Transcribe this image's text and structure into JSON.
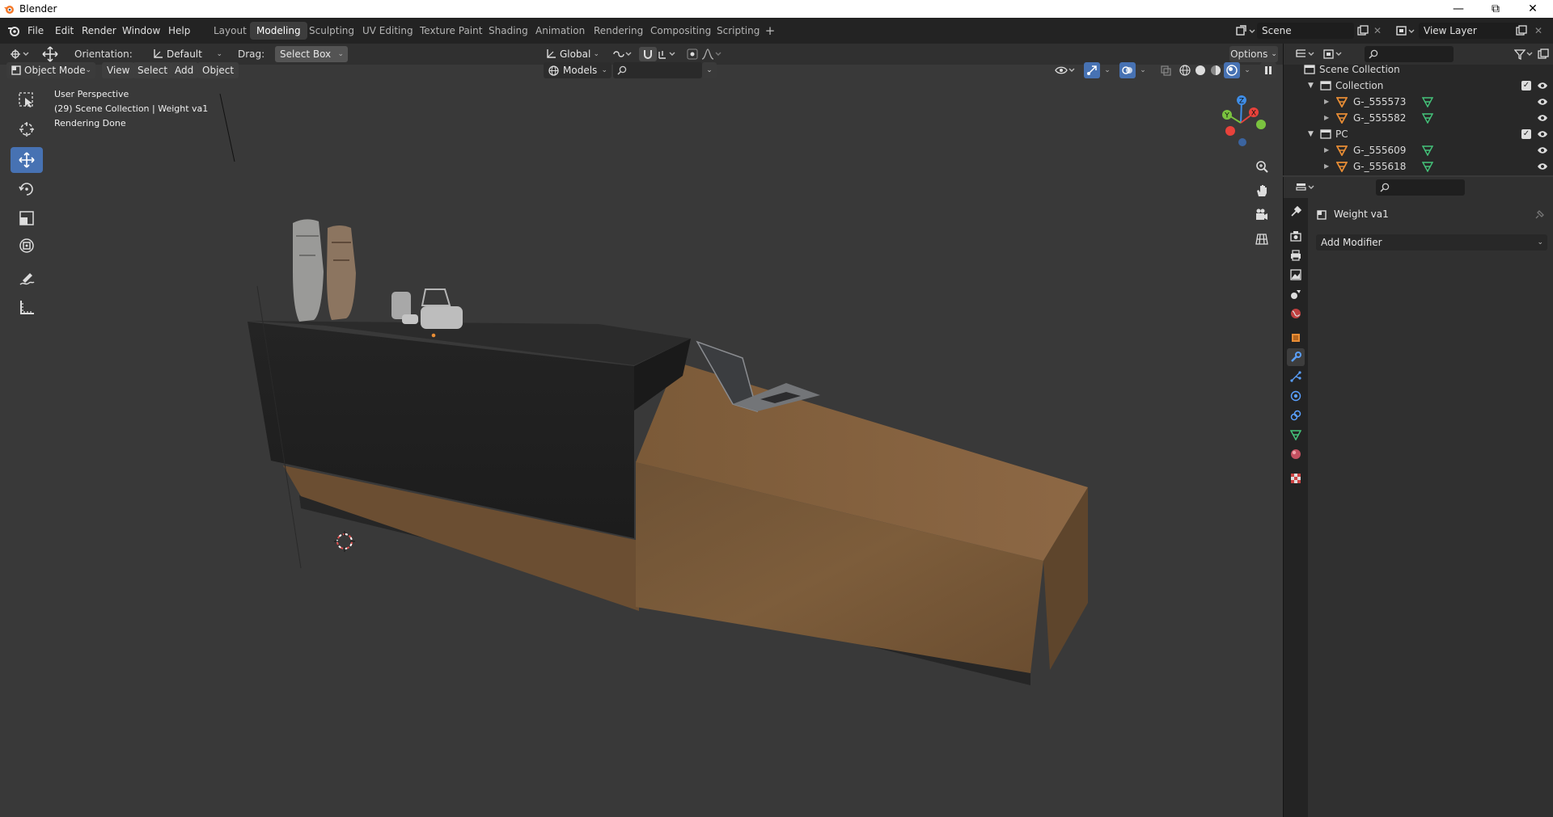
{
  "window": {
    "title": "Blender"
  },
  "menus": [
    "File",
    "Edit",
    "Render",
    "Window",
    "Help"
  ],
  "workspaces": [
    "Layout",
    "Modeling",
    "Sculpting",
    "UV Editing",
    "Texture Paint",
    "Shading",
    "Animation",
    "Rendering",
    "Compositing",
    "Scripting"
  ],
  "scene": {
    "name": "Scene",
    "view_layer": "View Layer"
  },
  "header": {
    "orientation_label": "Orientation:",
    "orientation_value": "Default",
    "drag_label": "Drag:",
    "drag_value": "Select Box",
    "transform_orientation": "Global",
    "options": "Options"
  },
  "viewport_header": {
    "mode": "Object Mode",
    "menus": [
      "View",
      "Select",
      "Add",
      "Object"
    ],
    "collection_filter": "Models"
  },
  "viewport": {
    "overlay_lines": [
      "User Perspective",
      "(29) Scene Collection | Weight va1",
      "Rendering Done"
    ],
    "gizmo_axes": [
      "Z",
      "X",
      "Y"
    ]
  },
  "outliner": {
    "root": "Scene Collection",
    "items": [
      {
        "name": "Collection",
        "type": "collection",
        "level": 1
      },
      {
        "name": "G-_555573",
        "type": "object",
        "level": 2
      },
      {
        "name": "G-_555582",
        "type": "object",
        "level": 2
      },
      {
        "name": "PC",
        "type": "collection",
        "level": 1
      },
      {
        "name": "G-_555609",
        "type": "object",
        "level": 2
      },
      {
        "name": "G-_555618",
        "type": "object",
        "level": 2
      }
    ]
  },
  "properties": {
    "object_name": "Weight va1",
    "add_modifier": "Add Modifier"
  },
  "colors": {
    "accent": "#4772b3",
    "object_orange": "#e88d35",
    "mesh_green": "#44c47a",
    "axis_x": "#e8423b",
    "axis_y": "#7ac33f",
    "axis_z": "#3f8ee8"
  }
}
